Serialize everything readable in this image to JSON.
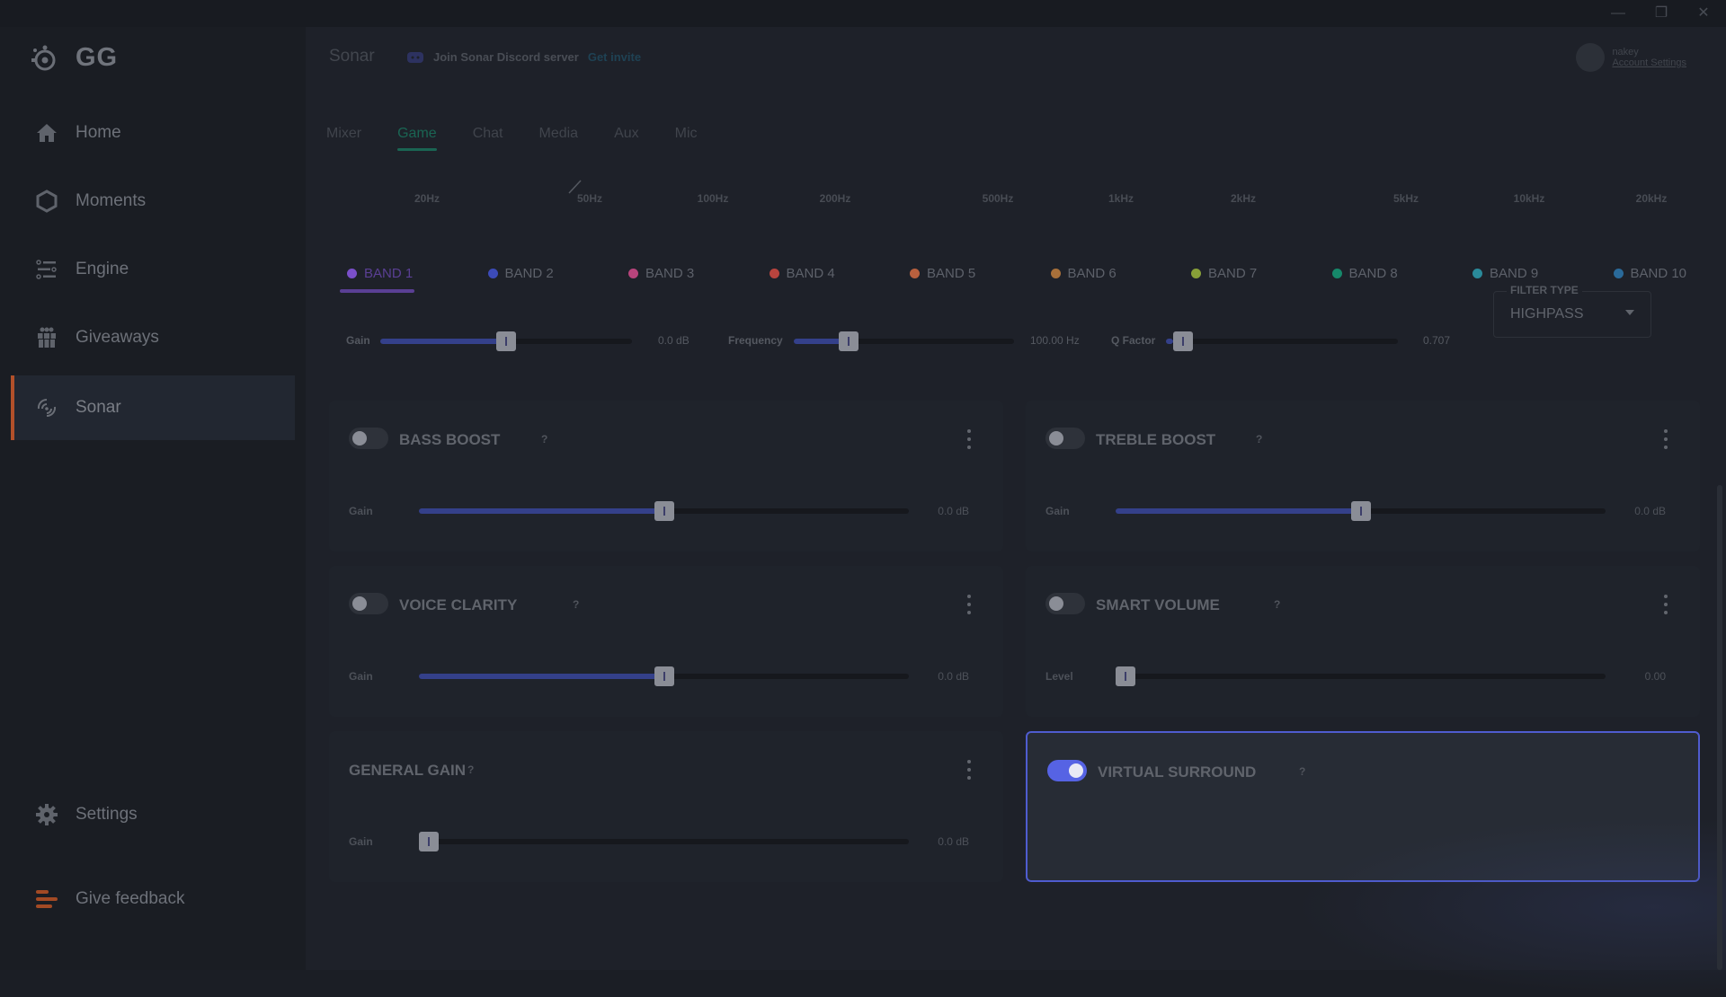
{
  "window": {
    "controls": {
      "minimize": "—",
      "restore": "❐",
      "close": "✕"
    }
  },
  "app": {
    "logo_text": "GG"
  },
  "sidebar": {
    "items": [
      {
        "label": "Home",
        "icon": "home-icon"
      },
      {
        "label": "Moments",
        "icon": "hexagon-icon"
      },
      {
        "label": "Engine",
        "icon": "sliders-icon"
      },
      {
        "label": "Giveaways",
        "icon": "gift-icon"
      },
      {
        "label": "Sonar",
        "icon": "sonar-icon",
        "active": true
      }
    ],
    "bottom": [
      {
        "label": "Settings",
        "icon": "gear-icon"
      },
      {
        "label": "Give feedback",
        "icon": "feedback-icon"
      }
    ],
    "accent": "#b2502a"
  },
  "header": {
    "title": "Sonar",
    "discord_text": "Join Sonar Discord server",
    "discord_link": "Get invite",
    "account_name": "nakey",
    "account_link": "Account Settings"
  },
  "tabs": [
    {
      "label": "Mixer"
    },
    {
      "label": "Game",
      "active": true
    },
    {
      "label": "Chat"
    },
    {
      "label": "Media"
    },
    {
      "label": "Aux"
    },
    {
      "label": "Mic"
    }
  ],
  "freq_axis": [
    "20Hz",
    "50Hz",
    "100Hz",
    "200Hz",
    "500Hz",
    "1kHz",
    "2kHz",
    "5kHz",
    "10kHz",
    "20kHz"
  ],
  "bands": [
    {
      "label": "BAND 1",
      "color": "#7a4fc9",
      "active": true
    },
    {
      "label": "BAND 2",
      "color": "#3c4bb8"
    },
    {
      "label": "BAND 3",
      "color": "#b8447c"
    },
    {
      "label": "BAND 4",
      "color": "#b8443e"
    },
    {
      "label": "BAND 5",
      "color": "#b8603e"
    },
    {
      "label": "BAND 6",
      "color": "#a8703a"
    },
    {
      "label": "BAND 7",
      "color": "#88a038"
    },
    {
      "label": "BAND 8",
      "color": "#16886a"
    },
    {
      "label": "BAND 9",
      "color": "#2a8a9a"
    },
    {
      "label": "BAND 10",
      "color": "#2a6a9a"
    }
  ],
  "band_params": {
    "gain": {
      "label": "Gain",
      "value": "0.0 dB",
      "fraction": 0.5
    },
    "frequency": {
      "label": "Frequency",
      "value": "100.00 Hz",
      "fraction": 0.25
    },
    "q_factor": {
      "label": "Q Factor",
      "value": "0.707",
      "fraction": 0.03
    },
    "filter_type": {
      "label": "FILTER TYPE",
      "value": "HIGHPASS"
    }
  },
  "effects": [
    {
      "title": "BASS BOOST",
      "enabled": false,
      "control_label": "Gain",
      "value": "0.0 dB",
      "fraction": 0.5,
      "has_toggle": true
    },
    {
      "title": "TREBLE BOOST",
      "enabled": false,
      "control_label": "Gain",
      "value": "0.0 dB",
      "fraction": 0.5,
      "has_toggle": true
    },
    {
      "title": "VOICE CLARITY",
      "enabled": false,
      "control_label": "Gain",
      "value": "0.0 dB",
      "fraction": 0.5,
      "has_toggle": true
    },
    {
      "title": "SMART VOLUME",
      "enabled": false,
      "control_label": "Level",
      "value": "0.00",
      "fraction": 0.0,
      "has_toggle": true
    },
    {
      "title": "GENERAL GAIN",
      "enabled": false,
      "control_label": "Gain",
      "value": "0.0 dB",
      "fraction": 0.0,
      "has_toggle": false
    },
    {
      "title": "VIRTUAL SURROUND",
      "enabled": true,
      "has_toggle": true
    }
  ],
  "help_glyph": "?"
}
